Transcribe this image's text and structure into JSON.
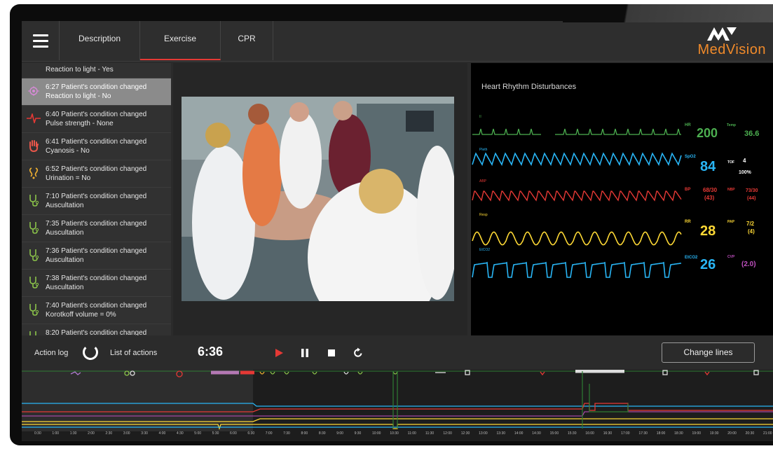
{
  "header": {
    "tabs": [
      {
        "label": "Description"
      },
      {
        "label": "Exercise"
      },
      {
        "label": "CPR"
      }
    ],
    "logo_text": "MedVision"
  },
  "action_log": {
    "top_text": "Reaction to light - Yes",
    "items": [
      {
        "icon": "pupil-icon",
        "line1": "6:27 Patient's condition changed",
        "line2": "Reaction to light - No",
        "color": "#d68ad6"
      },
      {
        "icon": "pulse-icon",
        "line1": "6:40 Patient's condition changed",
        "line2": "Pulse strength - None",
        "color": "#e53935"
      },
      {
        "icon": "hand-icon",
        "line1": "6:41 Patient's condition changed",
        "line2": "Cyanosis - No",
        "color": "#e8564a"
      },
      {
        "icon": "kidney-icon",
        "line1": "6:52 Patient's condition changed",
        "line2": "Urination = No",
        "color": "#f0b030"
      },
      {
        "icon": "stethoscope-icon",
        "line1": "7:10 Patient's condition changed",
        "line2": "Auscultation",
        "color": "#8bc34a"
      },
      {
        "icon": "stethoscope-icon",
        "line1": "7:35 Patient's condition changed",
        "line2": "Auscultation",
        "color": "#8bc34a"
      },
      {
        "icon": "stethoscope-icon",
        "line1": "7:36 Patient's condition changed",
        "line2": "Auscultation",
        "color": "#8bc34a"
      },
      {
        "icon": "stethoscope-icon",
        "line1": "7:38 Patient's condition changed",
        "line2": "Auscultation",
        "color": "#8bc34a"
      },
      {
        "icon": "stethoscope-icon",
        "line1": "7:40 Patient's condition changed",
        "line2": "Korotkoff volume = 0%",
        "color": "#8bc34a"
      },
      {
        "icon": "stethoscope-icon",
        "line1": "8:20 Patient's condition changed",
        "line2": "",
        "color": "#8bc34a"
      }
    ],
    "footer": {
      "action_log_label": "Action log",
      "list_of_actions_label": "List of actions"
    }
  },
  "monitor": {
    "title": "Heart Rhythm Disturbances",
    "traces": [
      {
        "label": "II",
        "color": "#4caf50"
      },
      {
        "label": "Pleth",
        "color": "#29b6f6"
      },
      {
        "label": "ABP",
        "color": "#e53935"
      },
      {
        "label": "Resp",
        "color": "#fdd835"
      },
      {
        "label": "EtCO2",
        "color": "#29b6f6"
      }
    ],
    "vitals": {
      "hr_label": "HR",
      "hr_value": "200",
      "temp_label": "Temp",
      "temp_value": "36.6",
      "spo2_label": "SpO2",
      "spo2_value": "84",
      "tof_label": "TOF",
      "tof_value": "4",
      "tof_pct": "100%",
      "bp_label": "BP",
      "bp_value": "68/30",
      "bp_mean": "(43)",
      "nbp_label": "NBP",
      "nbp_value": "73/30",
      "nbp_mean": "(44)",
      "rr_label": "RR",
      "rr_value": "28",
      "pap_label": "PAP",
      "pap_value": "7/2",
      "pap_mean": "(4)",
      "etco2_label": "EtCO2",
      "etco2_value": "26",
      "cvp_label": "CVP",
      "cvp_value": "(2.0)"
    }
  },
  "controls": {
    "time": "6:36",
    "change_lines_label": "Change lines"
  },
  "timeline": {
    "ticks": [
      "0:30",
      "1:00",
      "1:30",
      "2:00",
      "2:30",
      "3:00",
      "3:30",
      "4:00",
      "4:30",
      "5:00",
      "5:30",
      "6:00",
      "6:30",
      "7:00",
      "7:30",
      "8:00",
      "8:30",
      "9:00",
      "9:30",
      "10:00",
      "10:30",
      "11:00",
      "11:30",
      "12:00",
      "12:30",
      "13:00",
      "13:30",
      "14:00",
      "14:30",
      "15:00",
      "15:30",
      "16:00",
      "16:30",
      "17:00",
      "17:30",
      "18:00",
      "18:30",
      "19:00",
      "19:30",
      "20:00",
      "20:30",
      "21:00"
    ]
  },
  "colors": {
    "accent": "#e53935",
    "brand": "#f08a2a"
  }
}
